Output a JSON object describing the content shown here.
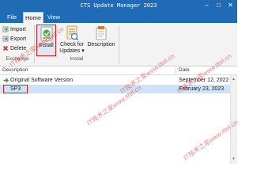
{
  "window": {
    "title": "CTS Update Manager 2023",
    "controls": {
      "minimize": "–",
      "maximize": "□",
      "close": "✕"
    },
    "title_bar_color": "#1f6bb5"
  },
  "menu": {
    "file": "File",
    "home": "Home",
    "view": "View"
  },
  "ribbon": {
    "exchange": {
      "import_label": "Import",
      "export_label": "Export",
      "delete_label": "Delete",
      "group_label": "Exchange"
    },
    "install": {
      "install_label": "Install",
      "check_label": "Check for Updates",
      "check_arrow": "▾",
      "description_label": "Description",
      "group_label": "Install"
    }
  },
  "table": {
    "columns": {
      "description": "Description",
      "date": "Date"
    },
    "rows": [
      {
        "description": "Original Software Version",
        "date": "September 12, 2022",
        "icon": "green-arrow-right-icon"
      },
      {
        "description": "SP3",
        "date": "February 23, 2023"
      }
    ],
    "selected_row_color": "#cfe3f7",
    "highlight_color": "#e01515"
  },
  "scrollbar": {
    "up": "▲",
    "down": "▼"
  },
  "watermark": {
    "texts": [
      "IT技术之家www.ittel.cn",
      "IT技术之家www.ittel.cn",
      "IT技术之家www.ittel.cn",
      "IT技术之家www.ittel.cn",
      "IT技术之家www.ittel.cn"
    ]
  }
}
